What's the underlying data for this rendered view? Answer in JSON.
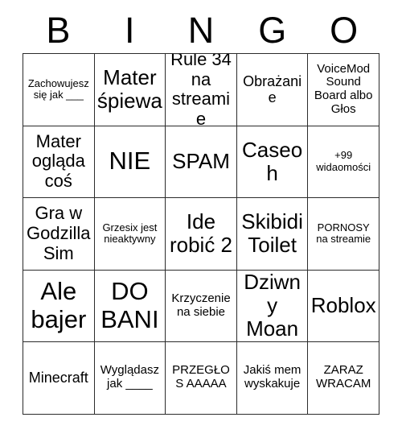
{
  "card": {
    "type": "bingo-card",
    "header_letters": [
      "B",
      "I",
      "N",
      "G",
      "O"
    ],
    "grid_size": "5x5",
    "colors": {
      "background": "#ffffff",
      "text": "#000000",
      "border": "#2b2b2b"
    },
    "rows": [
      [
        {
          "text": "Zachowujesz się jak ___",
          "size": "xs"
        },
        {
          "text": "Mater śpiewa",
          "size": "xl"
        },
        {
          "text": "Rule 34 na streamie",
          "size": "lg"
        },
        {
          "text": "Obrażanie",
          "size": "md"
        },
        {
          "text": "VoiceMod Sound Board albo Głos",
          "size": "sm"
        }
      ],
      [
        {
          "text": "Mater ogląda coś",
          "size": "lg"
        },
        {
          "text": "NIE",
          "size": "xxl"
        },
        {
          "text": "SPAM",
          "size": "xl"
        },
        {
          "text": "Caseoh",
          "size": "xl"
        },
        {
          "text": "+99 widaomości",
          "size": "xs"
        }
      ],
      [
        {
          "text": "Gra w Godzilla Sim",
          "size": "lg"
        },
        {
          "text": "Grzesix jest nieaktywny",
          "size": "xs"
        },
        {
          "text": "Ide robić 2",
          "size": "xl"
        },
        {
          "text": "Skibidi Toilet",
          "size": "xl"
        },
        {
          "text": "PORNOSY na streamie",
          "size": "xs"
        }
      ],
      [
        {
          "text": "Ale bajer",
          "size": "xxl"
        },
        {
          "text": "DO BANI",
          "size": "xxl"
        },
        {
          "text": "Krzyczenie na siebie",
          "size": "sm"
        },
        {
          "text": "Dziwny Moan",
          "size": "xl"
        },
        {
          "text": "Roblox",
          "size": "xl"
        }
      ],
      [
        {
          "text": "Minecraft",
          "size": "md"
        },
        {
          "text": "Wyglądasz jak ____",
          "size": "sm"
        },
        {
          "text": "PRZEGŁOS AAAAA",
          "size": "sm"
        },
        {
          "text": "Jakiś mem wyskakuje",
          "size": "sm"
        },
        {
          "text": "ZARAZ WRACAM",
          "size": "sm"
        }
      ]
    ]
  }
}
